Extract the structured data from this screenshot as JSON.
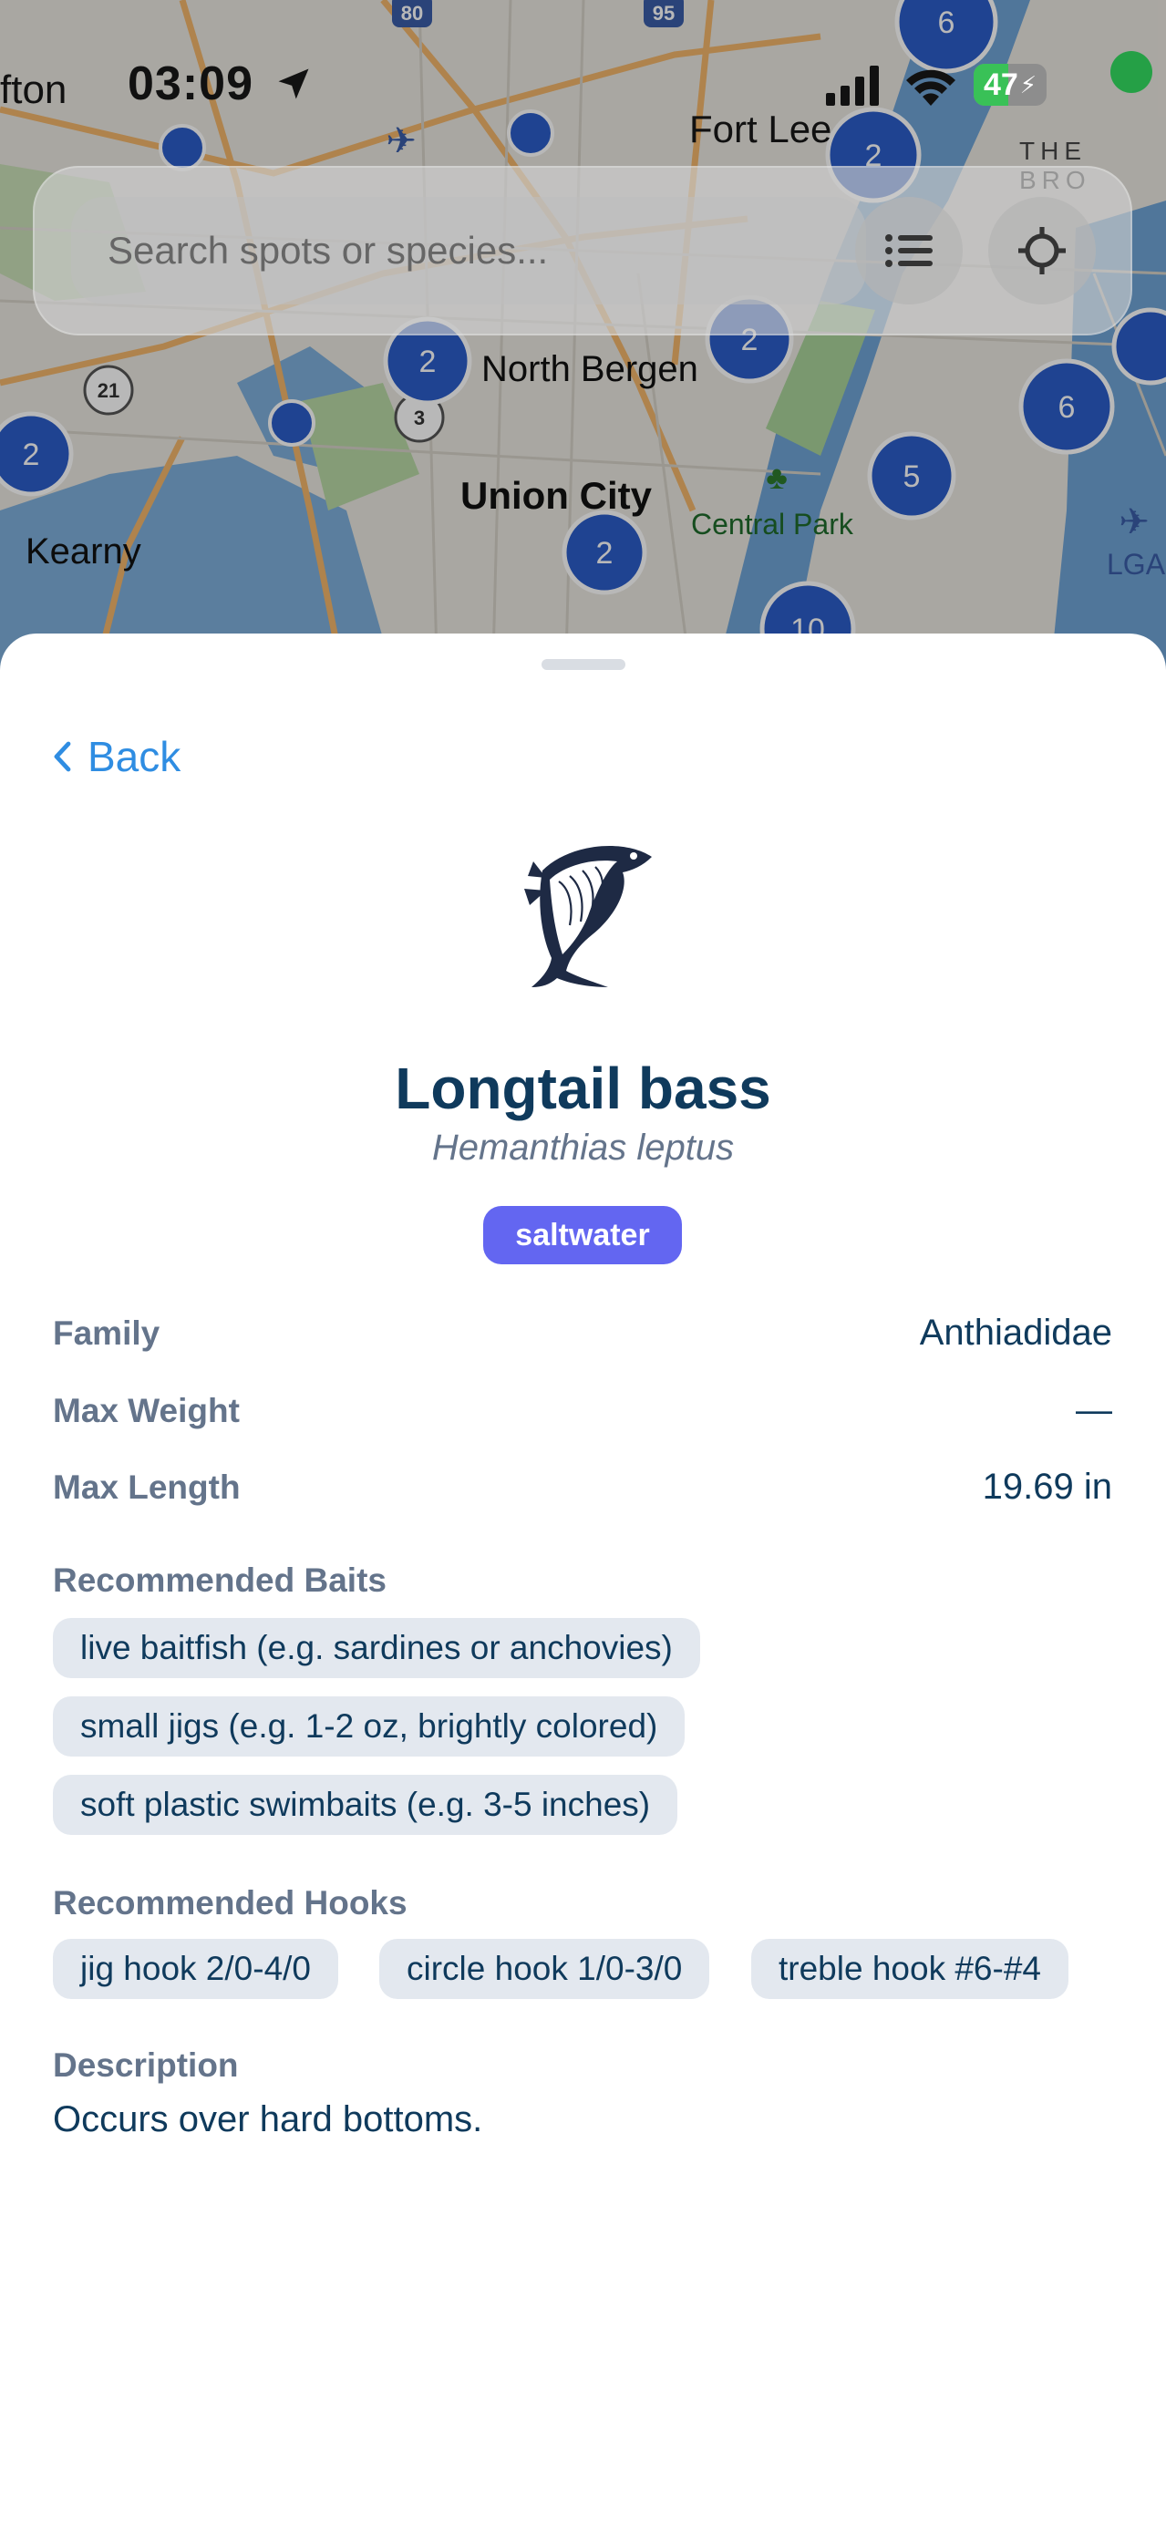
{
  "status_bar": {
    "time": "03:09",
    "battery": "47",
    "partial_place_left": "fton"
  },
  "map": {
    "labels": {
      "fort_lee": "Fort Lee",
      "the_bronx": "THE BRO",
      "north_bergen": "North Bergen",
      "union_city": "Union City",
      "central_park": "Central Park",
      "kearny": "Kearny",
      "lga": "LGA"
    },
    "highway_shields": [
      "80",
      "95",
      "21",
      "3"
    ],
    "cluster_counts": [
      "6",
      "2",
      "2",
      "2",
      "6",
      "5",
      "2",
      "10",
      "2"
    ]
  },
  "search": {
    "placeholder": "Search spots or species..."
  },
  "detail": {
    "back_label": "Back",
    "common_name": "Longtail bass",
    "scientific_name": "Hemanthias leptus",
    "water_type": "saltwater",
    "accent_color": "#6366f1",
    "fields": [
      {
        "label": "Family",
        "value": "Anthiadidae"
      },
      {
        "label": "Max Weight",
        "value": "—"
      },
      {
        "label": "Max Length",
        "value": "19.69 in"
      }
    ],
    "baits_heading": "Recommended Baits",
    "baits": [
      "live baitfish (e.g. sardines or anchovies)",
      "small jigs (e.g. 1-2 oz, brightly colored)",
      "soft plastic swimbaits (e.g. 3-5 inches)"
    ],
    "hooks_heading": "Recommended Hooks",
    "hooks": [
      "jig hook 2/0-4/0",
      "circle hook 1/0-3/0",
      "treble hook #6-#4"
    ],
    "description_heading": "Description",
    "description": "Occurs over hard bottoms."
  }
}
